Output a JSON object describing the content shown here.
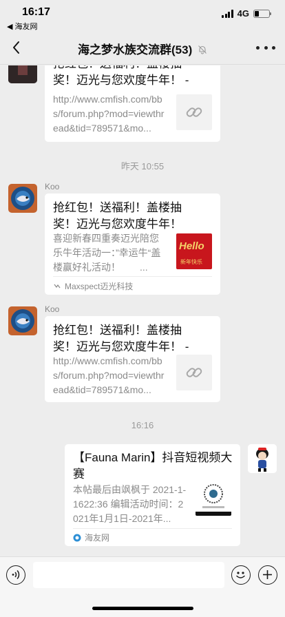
{
  "status_bar": {
    "time": "16:17",
    "back_app": "◀ 海友网",
    "network": "4G",
    "battery_level": 0.3
  },
  "nav": {
    "title": "海之梦水族交流群(53)"
  },
  "messages": [
    {
      "card": {
        "title": "抢红包！送福利！盖楼抽奖！迈光与您欢度牛年！ - ...",
        "desc": "http://www.cmfish.com/bbs/forum.php?mod=viewthread&tid=789571&mo...",
        "thumb": "link-icon"
      }
    },
    {
      "sender": "Koo",
      "card": {
        "title": "抢红包！送福利！盖楼抽奖！迈光与您欢度牛年！",
        "desc": "喜迎新春四重奏迈光陪您乐牛年活动一：”幸运牛“盖楼赢好礼活动！　　...",
        "thumb_text": "Hello",
        "thumb_sub": "新年快乐",
        "source": "Maxspect迈光科技"
      }
    },
    {
      "sender": "Koo",
      "card": {
        "title": "抢红包！送福利！盖楼抽奖！迈光与您欢度牛年！ - ...",
        "desc": "http://www.cmfish.com/bbs/forum.php?mod=viewthread&tid=789571&mo...",
        "thumb": "link-icon"
      }
    },
    {
      "own": true,
      "card": {
        "title": "【Fauna Marin】抖音短视频大赛",
        "desc": "本帖最后由飒枫于 2021-1-1622:36 编辑活动时间：2021年1月1日-2021年...",
        "source": "海友网"
      }
    }
  ],
  "time_labels": {
    "yesterday": "昨天 10:55",
    "today": "16:16"
  },
  "input": {
    "placeholder": ""
  },
  "colors": {
    "background": "#ededed",
    "card": "#ffffff",
    "accent_red": "#c8161d"
  }
}
